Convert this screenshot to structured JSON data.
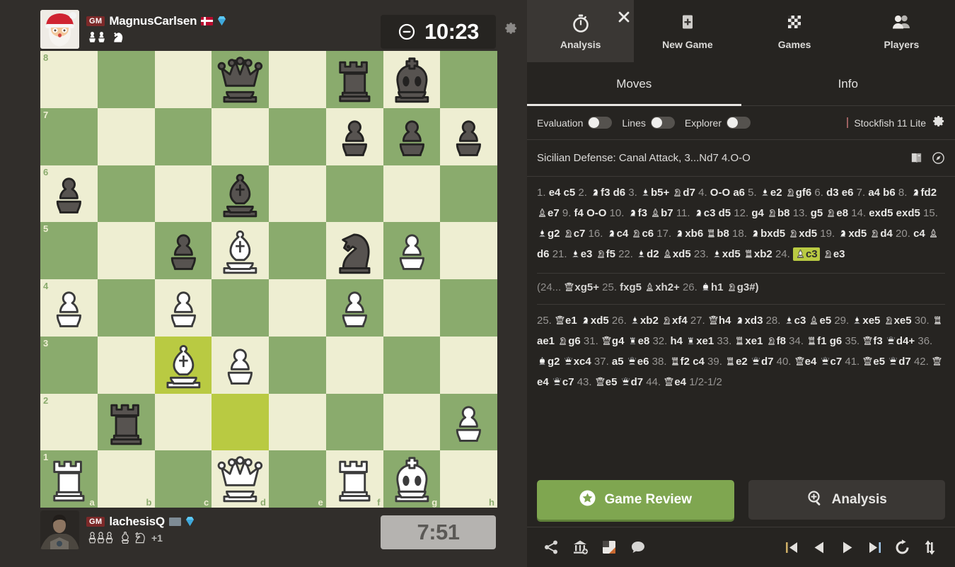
{
  "players": {
    "top": {
      "title": "GM",
      "username": "MagnusCarlsen",
      "flag": "norway-flag-icon",
      "badge": "diamond-membership-icon",
      "clock": "10:23",
      "clock_state": "active",
      "captured": [
        "pawn",
        "pawn",
        "knight"
      ],
      "advantage": ""
    },
    "bottom": {
      "title": "GM",
      "username": "lachesisQ",
      "flag": "gray-flag-icon",
      "badge": "diamond-membership-icon",
      "clock": "7:51",
      "clock_state": "idle",
      "captured": [
        "pawn",
        "pawn",
        "pawn",
        "bishop",
        "knight"
      ],
      "advantage": "+1"
    }
  },
  "board": {
    "orientation": "white",
    "files": [
      "a",
      "b",
      "c",
      "d",
      "e",
      "f",
      "g",
      "h"
    ],
    "ranks": [
      "8",
      "7",
      "6",
      "5",
      "4",
      "3",
      "2",
      "1"
    ],
    "light_color": "#eeeed2",
    "dark_color": "#8aab6d",
    "highlight_light": "#f5f582",
    "highlight_dark": "#b9ca42",
    "highlighted_squares": [
      "c3",
      "d2"
    ],
    "position": [
      [
        "",
        "",
        "",
        "bq",
        "",
        "br",
        "bk",
        ""
      ],
      [
        "",
        "",
        "",
        "",
        "",
        "bp",
        "bp",
        "bp"
      ],
      [
        "bp",
        "",
        "",
        "bb",
        "",
        "",
        "",
        ""
      ],
      [
        "",
        "",
        "bp",
        "wb",
        "",
        "bn",
        "wp",
        ""
      ],
      [
        "wp",
        "",
        "wp",
        "",
        "",
        "wp",
        "",
        ""
      ],
      [
        "",
        "",
        "wb",
        "wp",
        "",
        "",
        "",
        ""
      ],
      [
        "",
        "br",
        "",
        "",
        "",
        "",
        "",
        "wp"
      ],
      [
        "wr",
        "",
        "",
        "wq",
        "",
        "wr",
        "wk",
        ""
      ]
    ]
  },
  "panel": {
    "top_tabs": [
      {
        "label": "Analysis",
        "icon": "stopwatch-icon",
        "active": true
      },
      {
        "label": "New Game",
        "icon": "plus-square-icon",
        "active": false
      },
      {
        "label": "Games",
        "icon": "checkerboard-icon",
        "active": false
      },
      {
        "label": "Players",
        "icon": "people-icon",
        "active": false
      }
    ],
    "close_label": "close-icon",
    "sub_tabs": [
      {
        "label": "Moves",
        "active": true
      },
      {
        "label": "Info",
        "active": false
      }
    ],
    "controls": [
      {
        "label": "Evaluation",
        "on": false
      },
      {
        "label": "Lines",
        "on": false
      },
      {
        "label": "Explorer",
        "on": false
      }
    ],
    "engine": {
      "name": "Stockfish 11 Lite",
      "settings_icon": "gear-icon"
    },
    "opening": {
      "name": "Sicilian Defense: Canal Attack, 3...Nd7 4.O-O",
      "icons": [
        "book-icon",
        "compass-icon"
      ]
    },
    "buttons": {
      "game_review": {
        "label": "Game Review",
        "icon": "star-badge-icon"
      },
      "analysis": {
        "label": "Analysis",
        "icon": "magnifier-plus-icon"
      }
    },
    "footer_left_icons": [
      "share-icon",
      "archive-add-icon",
      "board-image-icon",
      "chat-icon"
    ],
    "footer_right_icons": [
      "first-move-icon",
      "previous-move-icon",
      "next-move-icon",
      "last-move-icon",
      "refresh-icon",
      "flip-board-icon"
    ]
  },
  "movelist": {
    "main_part1": [
      {
        "n": "1."
      },
      {
        "m": "e4"
      },
      {
        "m": "c5"
      },
      {
        "n": "2."
      },
      {
        "m": "f3",
        "p": "wn"
      },
      {
        "m": "d6"
      },
      {
        "n": "3."
      },
      {
        "m": "b5+",
        "p": "wb"
      },
      {
        "m": "d7",
        "p": "bn"
      },
      {
        "n": "4."
      },
      {
        "m": "O-O"
      },
      {
        "m": "a6"
      },
      {
        "n": "5."
      },
      {
        "m": "e2",
        "p": "wb"
      },
      {
        "m": "gf6",
        "p": "bn"
      },
      {
        "n": "6."
      },
      {
        "m": "d3"
      },
      {
        "m": "e6"
      },
      {
        "n": "7."
      },
      {
        "m": "a4"
      },
      {
        "m": "b6"
      },
      {
        "n": "8."
      },
      {
        "m": "fd2",
        "p": "wn"
      },
      {
        "m": "e7",
        "p": "bb"
      },
      {
        "n": "9."
      },
      {
        "m": "f4"
      },
      {
        "m": "O-O"
      },
      {
        "n": "10."
      },
      {
        "m": "f3",
        "p": "wn"
      },
      {
        "m": "b7",
        "p": "bb"
      },
      {
        "n": "11."
      },
      {
        "m": "c3",
        "p": "wn"
      },
      {
        "m": "d5"
      },
      {
        "n": "12."
      },
      {
        "m": "g4"
      },
      {
        "m": "b8",
        "p": "bn"
      },
      {
        "n": "13."
      },
      {
        "m": "g5"
      },
      {
        "m": "e8",
        "p": "bn"
      },
      {
        "n": "14."
      },
      {
        "m": "exd5"
      },
      {
        "m": "exd5"
      },
      {
        "n": "15."
      },
      {
        "m": "g2",
        "p": "wb"
      },
      {
        "m": "c7",
        "p": "bn"
      },
      {
        "n": "16."
      },
      {
        "m": "c4",
        "p": "wn"
      },
      {
        "m": "c6",
        "p": "bn"
      },
      {
        "n": "17."
      },
      {
        "m": "xb6",
        "p": "wn"
      },
      {
        "m": "b8",
        "p": "br"
      },
      {
        "n": "18."
      },
      {
        "m": "bxd5",
        "p": "wn"
      },
      {
        "m": "xd5",
        "p": "bn"
      },
      {
        "n": "19."
      },
      {
        "m": "xd5",
        "p": "wn"
      },
      {
        "m": "d4",
        "p": "bn"
      },
      {
        "n": "20."
      },
      {
        "m": "c4"
      },
      {
        "m": "d6",
        "p": "bb"
      },
      {
        "n": "21."
      },
      {
        "m": "e3",
        "p": "wb"
      },
      {
        "m": "f5",
        "p": "bn"
      },
      {
        "n": "22."
      },
      {
        "m": "d2",
        "p": "wb"
      },
      {
        "m": "xd5",
        "p": "bb"
      },
      {
        "n": "23."
      },
      {
        "m": "xd5",
        "p": "wb"
      },
      {
        "m": "xb2",
        "p": "br"
      },
      {
        "n": "24."
      },
      {
        "m": "c3",
        "p": "wb",
        "hl": true
      },
      {
        "m": "e3",
        "p": "bn"
      }
    ],
    "variation": [
      {
        "n": "(24..."
      },
      {
        "m": "xg5+",
        "p": "bq"
      },
      {
        "n": "25."
      },
      {
        "m": "fxg5"
      },
      {
        "m": "xh2+",
        "p": "bb"
      },
      {
        "n": "26."
      },
      {
        "m": "h1",
        "p": "wk"
      },
      {
        "m": "g3#)",
        "p": "bn"
      }
    ],
    "main_part2": [
      {
        "n": "25."
      },
      {
        "m": "e1",
        "p": "bq"
      },
      {
        "m": "xd5",
        "p": "wn"
      },
      {
        "n": "26."
      },
      {
        "m": "xb2",
        "p": "wb"
      },
      {
        "m": "xf4",
        "p": "bn"
      },
      {
        "n": "27."
      },
      {
        "m": "h4",
        "p": "bq"
      },
      {
        "m": "xd3",
        "p": "wn"
      },
      {
        "n": "28."
      },
      {
        "m": "c3",
        "p": "wb"
      },
      {
        "m": "e5",
        "p": "bb"
      },
      {
        "n": "29."
      },
      {
        "m": "xe5",
        "p": "wb"
      },
      {
        "m": "xe5",
        "p": "bn"
      },
      {
        "n": "30."
      },
      {
        "m": "ae1",
        "p": "br"
      },
      {
        "m": "g6",
        "p": "bn"
      },
      {
        "n": "31."
      },
      {
        "m": "g4",
        "p": "bq"
      },
      {
        "m": "e8",
        "p": "wr"
      },
      {
        "n": "32."
      },
      {
        "m": "h4"
      },
      {
        "m": "xe1",
        "p": "wr"
      },
      {
        "n": "33."
      },
      {
        "m": "xe1",
        "p": "br"
      },
      {
        "m": "f8",
        "p": "bn"
      },
      {
        "n": "34."
      },
      {
        "m": "f1",
        "p": "br"
      },
      {
        "m": "g6"
      },
      {
        "n": "35."
      },
      {
        "m": "f3",
        "p": "bq"
      },
      {
        "m": "d4+",
        "p": "wq"
      },
      {
        "n": "36."
      },
      {
        "m": "g2",
        "p": "wk"
      },
      {
        "m": "xc4",
        "p": "wq"
      },
      {
        "n": "37."
      },
      {
        "m": "a5"
      },
      {
        "m": "e6",
        "p": "wq"
      },
      {
        "n": "38."
      },
      {
        "m": "f2",
        "p": "br"
      },
      {
        "m": "c4"
      },
      {
        "n": "39."
      },
      {
        "m": "e2",
        "p": "br"
      },
      {
        "m": "d7",
        "p": "wq"
      },
      {
        "n": "40."
      },
      {
        "m": "e4",
        "p": "bq"
      },
      {
        "m": "c7",
        "p": "wq"
      },
      {
        "n": "41."
      },
      {
        "m": "e5",
        "p": "bq"
      },
      {
        "m": "d7",
        "p": "wq"
      },
      {
        "n": "42."
      },
      {
        "m": "e4",
        "p": "bq"
      },
      {
        "m": "c7",
        "p": "wq"
      },
      {
        "n": "43."
      },
      {
        "m": "e5",
        "p": "bq"
      },
      {
        "m": "d7",
        "p": "wq"
      },
      {
        "n": "44."
      },
      {
        "m": "e4",
        "p": "bq"
      },
      {
        "n": "1/2-1/2"
      }
    ]
  }
}
